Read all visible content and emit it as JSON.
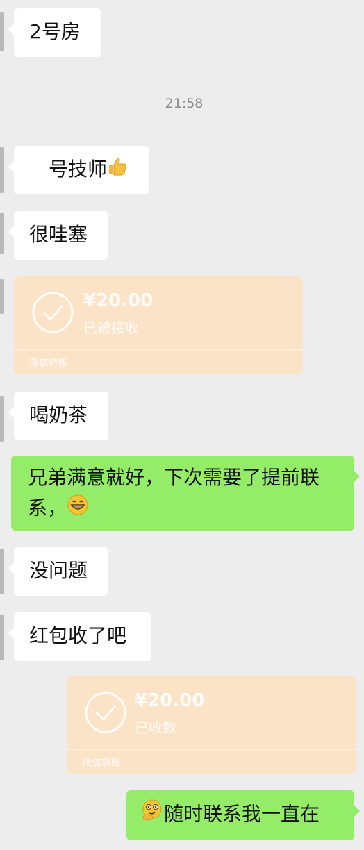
{
  "messages": {
    "m1": "2号房",
    "time": "21:58",
    "m2": "号技师",
    "m2_emoji": "thumbs-up-icon",
    "m3": "很哇塞",
    "m5": "喝奶茶",
    "m6_line1": "兄弟满意就好，下次需要了提前联",
    "m6_line2": "系，",
    "m6_emoji": "grinning-face-icon",
    "m7": "没问题",
    "m8": "红包收了吧",
    "m10": "随时联系我一直在",
    "m10_emoji": "thinking-face-icon"
  },
  "transfer_received": {
    "amount": "¥20.00",
    "status": "已被接收",
    "footer": "微信转账"
  },
  "transfer_collected": {
    "amount": "¥20.00",
    "status": "已收款",
    "footer": "微信转账"
  },
  "colors": {
    "background": "#ededed",
    "bubble_in": "#ffffff",
    "bubble_out": "#95ec69",
    "transfer": "#fbe3c8"
  }
}
